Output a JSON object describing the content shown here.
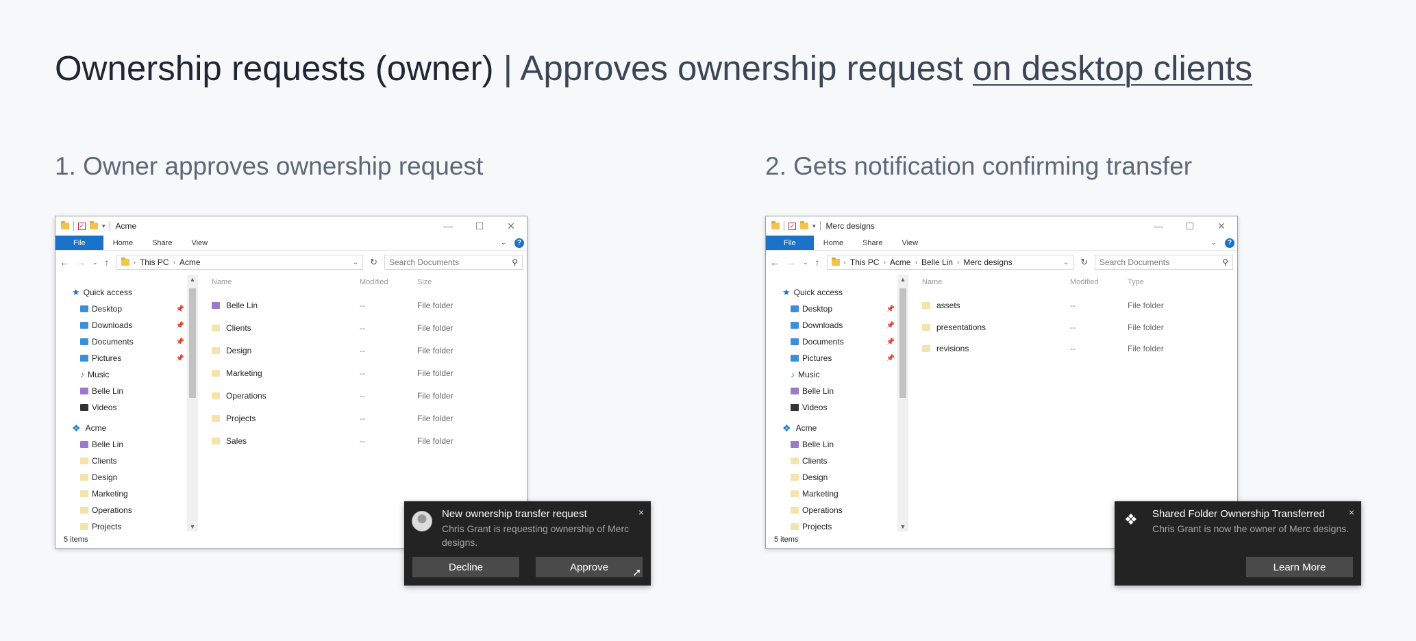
{
  "page": {
    "title_strong": "Ownership requests (owner)",
    "title_sep": " | ",
    "title_light": "Approves ownership request ",
    "title_link": "on desktop clients"
  },
  "steps": [
    {
      "title": "1. Owner approves ownership request"
    },
    {
      "title": "2. Gets notification confirming transfer"
    }
  ],
  "ribbon": {
    "file": "File",
    "home": "Home",
    "share": "Share",
    "view": "View"
  },
  "search_placeholder": "Search Documents",
  "nav": {
    "quick_access": "Quick access",
    "desktop": "Desktop",
    "downloads": "Downloads",
    "documents": "Documents",
    "pictures": "Pictures",
    "music": "Music",
    "belle_lin": "Belle Lin",
    "videos": "Videos",
    "acme": "Acme",
    "clients": "Clients",
    "design": "Design",
    "marketing": "Marketing",
    "operations": "Operations",
    "projects": "Projects"
  },
  "window1": {
    "title": "Acme",
    "breadcrumb": [
      "This PC",
      "Acme"
    ],
    "columns": [
      "Name",
      "Modified",
      "Size"
    ],
    "rows": [
      {
        "name": "Belle Lin",
        "modified": "--",
        "size": "File folder"
      },
      {
        "name": "Clients",
        "modified": "--",
        "size": "File folder"
      },
      {
        "name": "Design",
        "modified": "--",
        "size": "File folder"
      },
      {
        "name": "Marketing",
        "modified": "--",
        "size": "File folder"
      },
      {
        "name": "Operations",
        "modified": "--",
        "size": "File folder"
      },
      {
        "name": "Projects",
        "modified": "--",
        "size": "File folder"
      },
      {
        "name": "Sales",
        "modified": "--",
        "size": "File folder"
      }
    ],
    "status": "5 items"
  },
  "window2": {
    "title": "Merc designs",
    "breadcrumb": [
      "This PC",
      "Acme",
      "Belle Lin",
      "Merc designs"
    ],
    "columns": [
      "Name",
      "Modified",
      "Type"
    ],
    "rows": [
      {
        "name": "assets",
        "modified": "--",
        "size": "File folder"
      },
      {
        "name": "presentations",
        "modified": "--",
        "size": "File folder"
      },
      {
        "name": "revisions",
        "modified": "--",
        "size": "File folder"
      }
    ],
    "status": "5 items"
  },
  "toast1": {
    "title": "New ownership transfer request",
    "message": "Chris Grant is requesting ownership of Merc designs.",
    "decline": "Decline",
    "approve": "Approve",
    "close": "×"
  },
  "toast2": {
    "title": "Shared Folder Ownership Transferred",
    "message": "Chris Grant is now the owner of Merc designs.",
    "learn_more": "Learn More",
    "close": "×"
  }
}
